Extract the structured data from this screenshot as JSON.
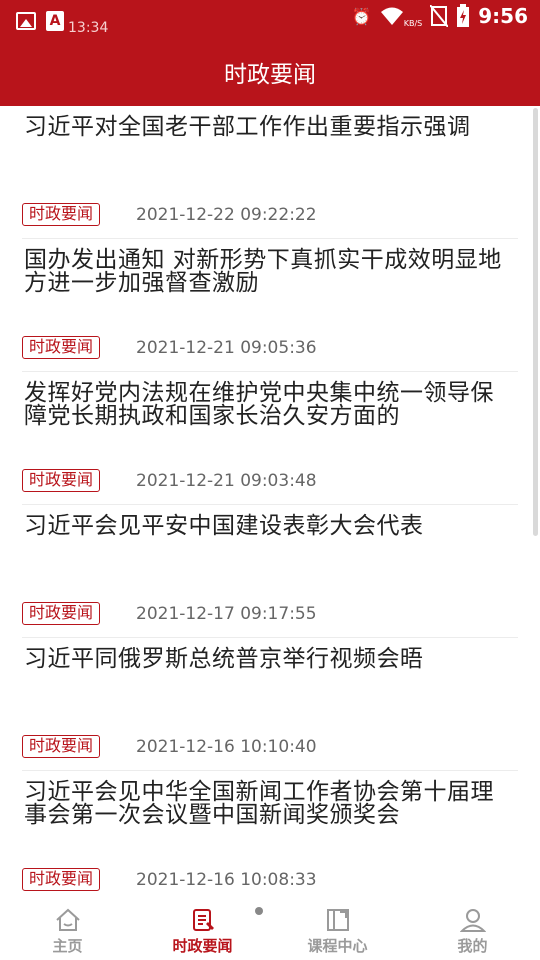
{
  "status_bar": {
    "small_time": "13:34",
    "time": "9:56",
    "network_label": "KB/S"
  },
  "header": {
    "title": "时政要闻"
  },
  "news": [
    {
      "title": "习近平对全国老干部工作作出重要指示强调",
      "tag": "时政要闻",
      "date": "2021-12-22 09:22:22"
    },
    {
      "title": "国办发出通知 对新形势下真抓实干成效明显地方进一步加强督查激励",
      "tag": "时政要闻",
      "date": "2021-12-21 09:05:36"
    },
    {
      "title": "发挥好党内法规在维护党中央集中统一领导保障党长期执政和国家长治久安方面的",
      "tag": "时政要闻",
      "date": "2021-12-21 09:03:48"
    },
    {
      "title": "习近平会见平安中国建设表彰大会代表",
      "tag": "时政要闻",
      "date": "2021-12-17 09:17:55"
    },
    {
      "title": "习近平同俄罗斯总统普京举行视频会晤",
      "tag": "时政要闻",
      "date": "2021-12-16 10:10:40"
    },
    {
      "title": "习近平会见中华全国新闻工作者协会第十届理事会第一次会议暨中国新闻奖颁奖会",
      "tag": "时政要闻",
      "date": "2021-12-16 10:08:33"
    }
  ],
  "tabs": [
    {
      "label": "主页",
      "icon": "home-icon",
      "active": false
    },
    {
      "label": "时政要闻",
      "icon": "news-icon",
      "active": true
    },
    {
      "label": "课程中心",
      "icon": "course-icon",
      "active": false
    },
    {
      "label": "我的",
      "icon": "profile-icon",
      "active": false
    }
  ],
  "colors": {
    "brand_red": "#b8141b",
    "inactive_gray": "#9a9a9a"
  }
}
